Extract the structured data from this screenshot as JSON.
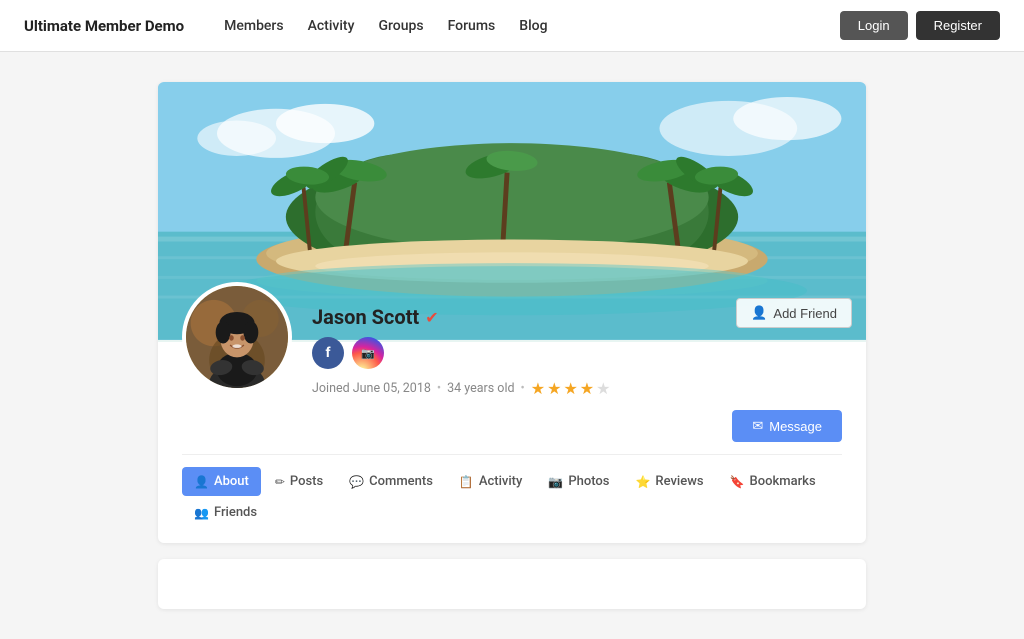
{
  "brand": "Ultimate Member Demo",
  "nav": {
    "links": [
      "Members",
      "Activity",
      "Groups",
      "Forums",
      "Blog"
    ],
    "login": "Login",
    "register": "Register"
  },
  "profile": {
    "name": "Jason Scott",
    "verified": true,
    "joined": "Joined June 05, 2018",
    "age": "34 years old",
    "rating": 3.5,
    "add_friend_label": "Add Friend",
    "message_label": "Message",
    "social": {
      "facebook": "f",
      "instagram": "in"
    },
    "tabs": [
      {
        "id": "about",
        "label": "About",
        "icon": "👤",
        "active": true
      },
      {
        "id": "posts",
        "label": "Posts",
        "icon": "✏️",
        "active": false
      },
      {
        "id": "comments",
        "label": "Comments",
        "icon": "💬",
        "active": false
      },
      {
        "id": "activity",
        "label": "Activity",
        "icon": "📋",
        "active": false
      },
      {
        "id": "photos",
        "label": "Photos",
        "icon": "📷",
        "active": false
      },
      {
        "id": "reviews",
        "label": "Reviews",
        "icon": "⭐",
        "active": false
      },
      {
        "id": "bookmarks",
        "label": "Bookmarks",
        "icon": "🔖",
        "active": false
      },
      {
        "id": "friends",
        "label": "Friends",
        "icon": "👥",
        "active": false
      }
    ]
  }
}
